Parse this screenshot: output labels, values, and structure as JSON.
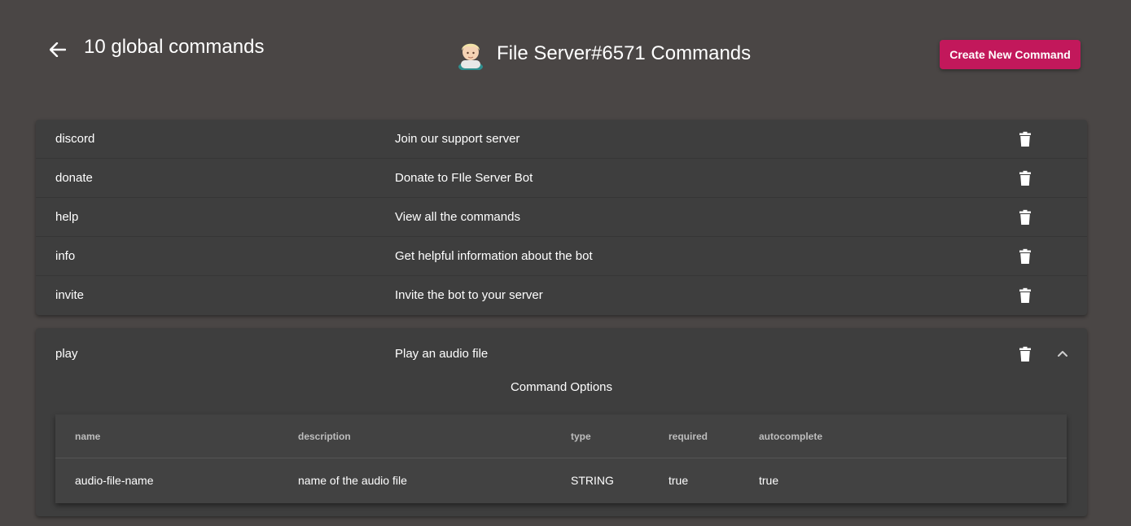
{
  "header": {
    "global_count_label": "10 global commands",
    "bot_title": "File Server#6571 Commands",
    "create_button_label": "Create New Command"
  },
  "commands": [
    {
      "name": "discord",
      "description": "Join our support server"
    },
    {
      "name": "donate",
      "description": "Donate to FIle Server Bot"
    },
    {
      "name": "help",
      "description": "View all the commands"
    },
    {
      "name": "info",
      "description": "Get helpful information about the bot"
    },
    {
      "name": "invite",
      "description": "Invite the bot to your server"
    }
  ],
  "expanded_command": {
    "name": "play",
    "description": "Play an audio file",
    "options_title": "Command Options",
    "columns": [
      "name",
      "description",
      "type",
      "required",
      "autocomplete"
    ],
    "rows": [
      {
        "name": "audio-file-name",
        "description": "name of the audio file",
        "type": "STRING",
        "required": "true",
        "autocomplete": "true"
      }
    ]
  },
  "colors": {
    "background": "#4a4645",
    "panel": "#3e3e3e",
    "accent": "#c2185b"
  },
  "icons": {
    "back": "arrow-left-icon",
    "avatar": "bot-avatar",
    "delete": "trash-icon",
    "collapse": "chevron-up-icon"
  }
}
